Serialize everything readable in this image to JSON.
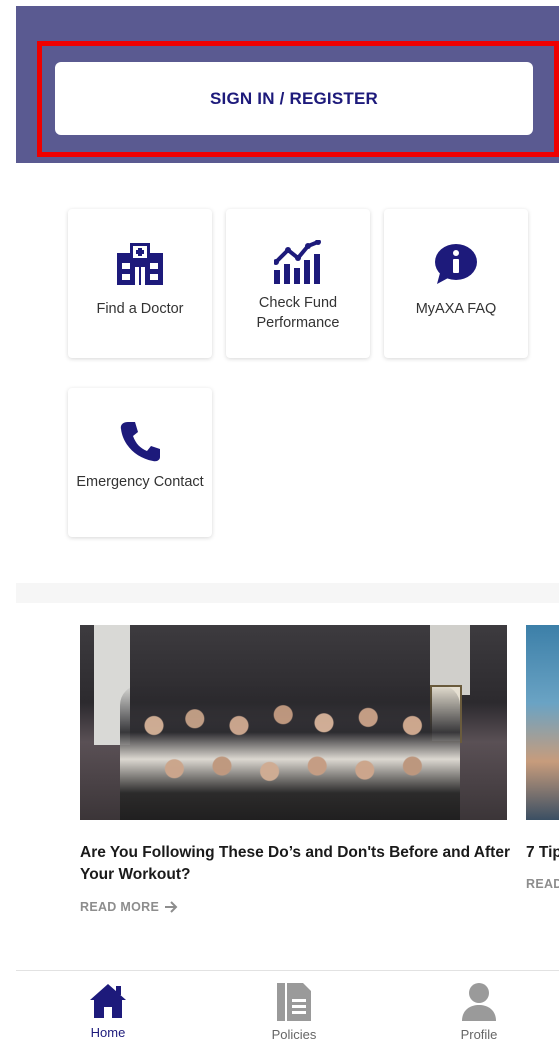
{
  "header": {
    "signin_label": "SIGN IN / REGISTER"
  },
  "quick_links": [
    {
      "label": "Find a Doctor",
      "icon": "hospital-icon"
    },
    {
      "label": "Check Fund Performance",
      "icon": "fund-chart-icon"
    },
    {
      "label": "MyAXA FAQ",
      "icon": "info-bubble-icon"
    },
    {
      "label": "Emergency Contact",
      "icon": "phone-icon"
    }
  ],
  "articles": [
    {
      "title": "Are You Following These Do’s and Don'ts Before and After Your Workout?",
      "read_more": "READ MORE",
      "image": "group-fitness-photo"
    },
    {
      "title": "7 Tip",
      "read_more": "READ",
      "image": "workout-photo"
    }
  ],
  "tabbar": {
    "items": [
      {
        "label": "Home",
        "icon": "home-icon",
        "active": true
      },
      {
        "label": "Policies",
        "icon": "document-icon",
        "active": false
      },
      {
        "label": "Profile",
        "icon": "person-icon",
        "active": false
      }
    ]
  },
  "colors": {
    "brand_navy": "#1d1a7b",
    "header_bg": "#5a5a91",
    "highlight_red": "#ee0000",
    "inactive_gray": "#9a9a9a"
  }
}
